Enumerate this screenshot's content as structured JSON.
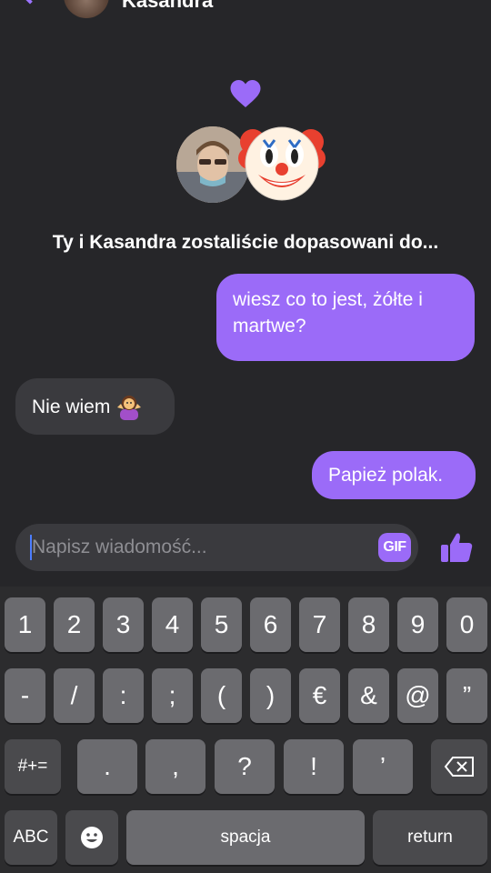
{
  "header": {
    "contact_name": "Kasandra"
  },
  "match": {
    "text": "Ty i Kasandra zostaliście dopasowani do..."
  },
  "messages": [
    {
      "direction": "out",
      "text": "wiesz co to jest, żółte i martwe?"
    },
    {
      "direction": "in",
      "text": "Nie wiem",
      "emoji": "person-shrugging"
    },
    {
      "direction": "out",
      "text": "Papież polak."
    }
  ],
  "composer": {
    "placeholder": "Napisz wiadomość...",
    "gif_label": "GIF"
  },
  "keyboard": {
    "row1": [
      "1",
      "2",
      "3",
      "4",
      "5",
      "6",
      "7",
      "8",
      "9",
      "0"
    ],
    "row2": [
      "-",
      "/",
      ":",
      ";",
      "(",
      ")",
      "€",
      "&",
      "@",
      "”"
    ],
    "row3": [
      "#+=",
      ".",
      ",",
      "?",
      "!",
      "’"
    ],
    "row4": [
      "ABC",
      "spacja",
      "return"
    ]
  },
  "colors": {
    "accent": "#9b6bf8",
    "background": "#262629",
    "incoming_bubble": "#3a3a3e"
  }
}
